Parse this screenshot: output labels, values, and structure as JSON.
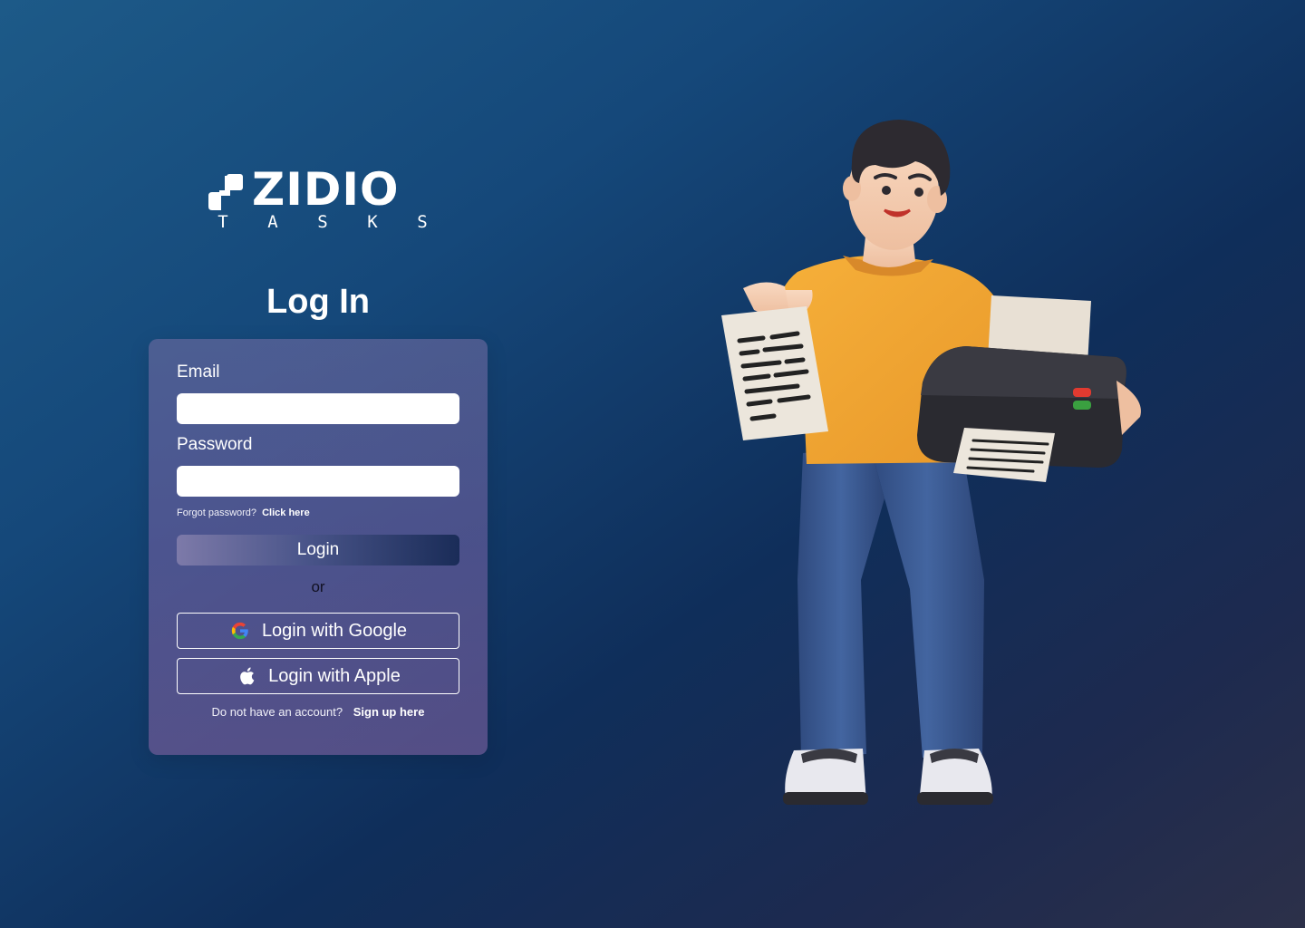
{
  "brand": {
    "name": "ZIDIO",
    "subtitle_letters": [
      "T",
      "A",
      "S",
      "K",
      "S"
    ]
  },
  "page": {
    "title": "Log In"
  },
  "form": {
    "email_label": "Email",
    "email_value": "",
    "password_label": "Password",
    "password_value": "",
    "forgot_text": "Forgot password?",
    "forgot_link": "Click here",
    "login_button": "Login",
    "or_text": "or",
    "google_button": "Login with Google",
    "apple_button": "Login with Apple",
    "signup_text": "Do not have an account?",
    "signup_link": "Sign up here"
  },
  "icons": {
    "google": "google-icon",
    "apple": "apple-icon",
    "logo": "zidio-logo-mark"
  },
  "colors": {
    "background_start": "#1d5a88",
    "background_end": "#2c3049",
    "card": "#6e5fa0",
    "button_start": "#7d7aa9",
    "button_end": "#1a2c58",
    "shirt": "#f0a531",
    "jeans": "#3f5d96"
  }
}
